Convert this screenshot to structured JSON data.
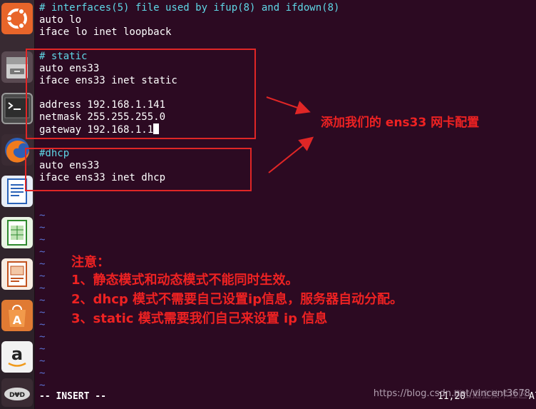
{
  "terminal": {
    "lines": [
      "# interfaces(5) file used by ifup(8) and ifdown(8)",
      "auto lo",
      "iface lo inet loopback",
      "",
      "# static",
      "auto ens33",
      "iface ens33 inet static",
      "",
      "address 192.168.1.141",
      "netmask 255.255.255.0",
      "gateway 192.168.1.1",
      "",
      "#dhcp",
      "auto ens33",
      "iface ens33 inet dhcp"
    ],
    "tilde": "~",
    "status_mode": "-- INSERT --",
    "status_position": "11,20",
    "status_scroll": "All"
  },
  "annotations": {
    "arrow_label": "添加我们的 ens33 网卡配置",
    "note_title": "注意：",
    "notes": [
      "1、静态模式和动态模式不能同时生效。",
      "2、dhcp 模式不需要自己设置ip信息，服务器自动分配。",
      "3、static 模式需要我们自己来设置 ip 信息"
    ],
    "color": "#e02626"
  },
  "launcher": {
    "icons": [
      "ubuntu-icon",
      "files-icon",
      "terminal-icon",
      "firefox-icon",
      "writer-icon",
      "calc-icon",
      "impress-icon",
      "software-center-icon",
      "amazon-icon",
      "dvd-icon"
    ]
  },
  "watermark": {
    "text": "https://blog.csdn.net/vincent3678",
    "overlay_text": "稀土掘金技术社区"
  }
}
